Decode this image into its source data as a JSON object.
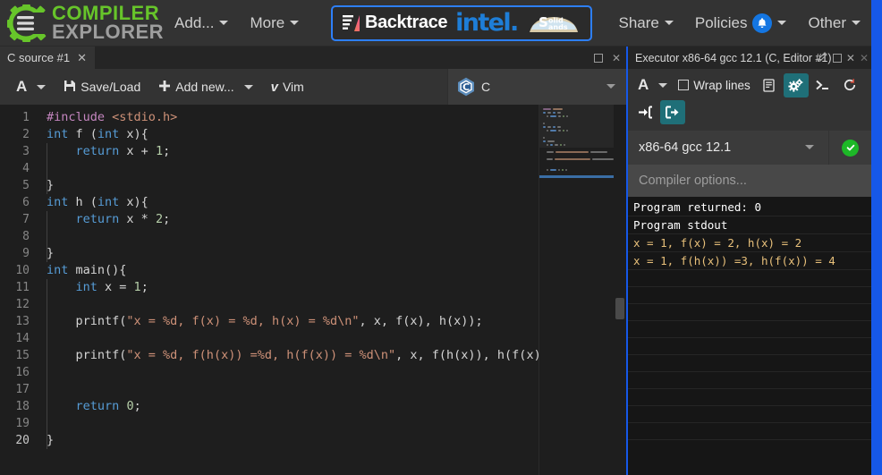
{
  "navbar": {
    "brand_line1": "COMPILER",
    "brand_line2": "EXPLORER",
    "items": [
      {
        "label": "Add...",
        "name": "nav-add"
      },
      {
        "label": "More",
        "name": "nav-more"
      }
    ],
    "sponsor": {
      "backtrace": "Backtrace",
      "intel": "intel.",
      "solidsands_top": "olid",
      "solidsands_bottom": "ands",
      "solidsands_s": "S"
    },
    "right_items": [
      {
        "label": "Share",
        "name": "nav-share"
      },
      {
        "label": "Policies",
        "name": "nav-policies"
      },
      {
        "label": "Other",
        "name": "nav-other"
      }
    ]
  },
  "editor": {
    "tab_label": "C source #1",
    "tab_close": "✕",
    "toolbar": {
      "font_label": "A",
      "save_load": "Save/Load",
      "add_new": "Add new...",
      "vim": "Vim",
      "vim_glyph": "ᴠ"
    },
    "language": "C",
    "line_count": 20,
    "lines": [
      {
        "n": 1,
        "indent": 0,
        "tokens": [
          {
            "t": "#include ",
            "c": "pp"
          },
          {
            "t": "<stdio.h>",
            "c": "inc"
          }
        ]
      },
      {
        "n": 2,
        "indent": 0,
        "tokens": [
          {
            "t": "int",
            "c": "k"
          },
          {
            "t": " f (",
            "c": "pun"
          },
          {
            "t": "int",
            "c": "k"
          },
          {
            "t": " x){",
            "c": "pun"
          }
        ]
      },
      {
        "n": 3,
        "indent": 1,
        "tokens": [
          {
            "t": "    ",
            "c": "pun"
          },
          {
            "t": "return",
            "c": "k"
          },
          {
            "t": " x + ",
            "c": "pun"
          },
          {
            "t": "1",
            "c": "num"
          },
          {
            "t": ";",
            "c": "pun"
          }
        ]
      },
      {
        "n": 4,
        "indent": 1,
        "tokens": []
      },
      {
        "n": 5,
        "indent": 0,
        "tokens": [
          {
            "t": "}",
            "c": "pun"
          }
        ]
      },
      {
        "n": 6,
        "indent": 0,
        "tokens": [
          {
            "t": "int",
            "c": "k"
          },
          {
            "t": " h (",
            "c": "pun"
          },
          {
            "t": "int",
            "c": "k"
          },
          {
            "t": " x){",
            "c": "pun"
          }
        ]
      },
      {
        "n": 7,
        "indent": 1,
        "tokens": [
          {
            "t": "    ",
            "c": "pun"
          },
          {
            "t": "return",
            "c": "k"
          },
          {
            "t": " x * ",
            "c": "pun"
          },
          {
            "t": "2",
            "c": "num"
          },
          {
            "t": ";",
            "c": "pun"
          }
        ]
      },
      {
        "n": 8,
        "indent": 1,
        "tokens": []
      },
      {
        "n": 9,
        "indent": 0,
        "tokens": [
          {
            "t": "}",
            "c": "pun"
          }
        ]
      },
      {
        "n": 10,
        "indent": 0,
        "tokens": [
          {
            "t": "int",
            "c": "k"
          },
          {
            "t": " main(){",
            "c": "pun"
          }
        ]
      },
      {
        "n": 11,
        "indent": 1,
        "tokens": [
          {
            "t": "    ",
            "c": "pun"
          },
          {
            "t": "int",
            "c": "k"
          },
          {
            "t": " x = ",
            "c": "pun"
          },
          {
            "t": "1",
            "c": "num"
          },
          {
            "t": ";",
            "c": "pun"
          }
        ]
      },
      {
        "n": 12,
        "indent": 1,
        "tokens": []
      },
      {
        "n": 13,
        "indent": 1,
        "tokens": [
          {
            "t": "    printf(",
            "c": "pun"
          },
          {
            "t": "\"x = %d, f(x) = %d, h(x) = %d\\n\"",
            "c": "str"
          },
          {
            "t": ", x, f(x), h(x));",
            "c": "pun"
          }
        ]
      },
      {
        "n": 14,
        "indent": 1,
        "tokens": []
      },
      {
        "n": 15,
        "indent": 1,
        "tokens": [
          {
            "t": "    printf(",
            "c": "pun"
          },
          {
            "t": "\"x = %d, f(h(x)) =%d, h(f(x)) = %d\\n\"",
            "c": "str"
          },
          {
            "t": ", x, f(h(x)), h(f(x)));",
            "c": "pun"
          }
        ]
      },
      {
        "n": 16,
        "indent": 1,
        "tokens": []
      },
      {
        "n": 17,
        "indent": 1,
        "tokens": []
      },
      {
        "n": 18,
        "indent": 1,
        "tokens": [
          {
            "t": "    ",
            "c": "pun"
          },
          {
            "t": "return",
            "c": "k"
          },
          {
            "t": " ",
            "c": "pun"
          },
          {
            "t": "0",
            "c": "num"
          },
          {
            "t": ";",
            "c": "pun"
          }
        ]
      },
      {
        "n": 19,
        "indent": 1,
        "tokens": []
      },
      {
        "n": 20,
        "indent": 0,
        "tokens": [
          {
            "t": "}",
            "c": "pun"
          }
        ]
      }
    ]
  },
  "executor": {
    "title": "Executor x86-64 gcc 12.1 (C, Editor #1)",
    "toolbar": {
      "font_label": "A",
      "wrap_lines": "Wrap lines"
    },
    "compiler": "x86-64 gcc 12.1",
    "options_placeholder": "Compiler options...",
    "output": [
      {
        "text": "Program returned: 0",
        "kind": "hdr"
      },
      {
        "text": "Program stdout",
        "kind": "hdr"
      },
      {
        "text": "x = 1, f(x) = 2, h(x) = 2",
        "kind": "std"
      },
      {
        "text": "x = 1, f(h(x)) =3, h(f(x)) = 4",
        "kind": "std"
      }
    ]
  },
  "colors": {
    "accent_green": "#67c52a",
    "page_blue": "#1658e8",
    "teal_active": "#1f6f78",
    "status_green": "#1db827",
    "navbar_bg": "#333333",
    "editor_bg": "#1e1e1e",
    "output_bg": "#161616"
  }
}
